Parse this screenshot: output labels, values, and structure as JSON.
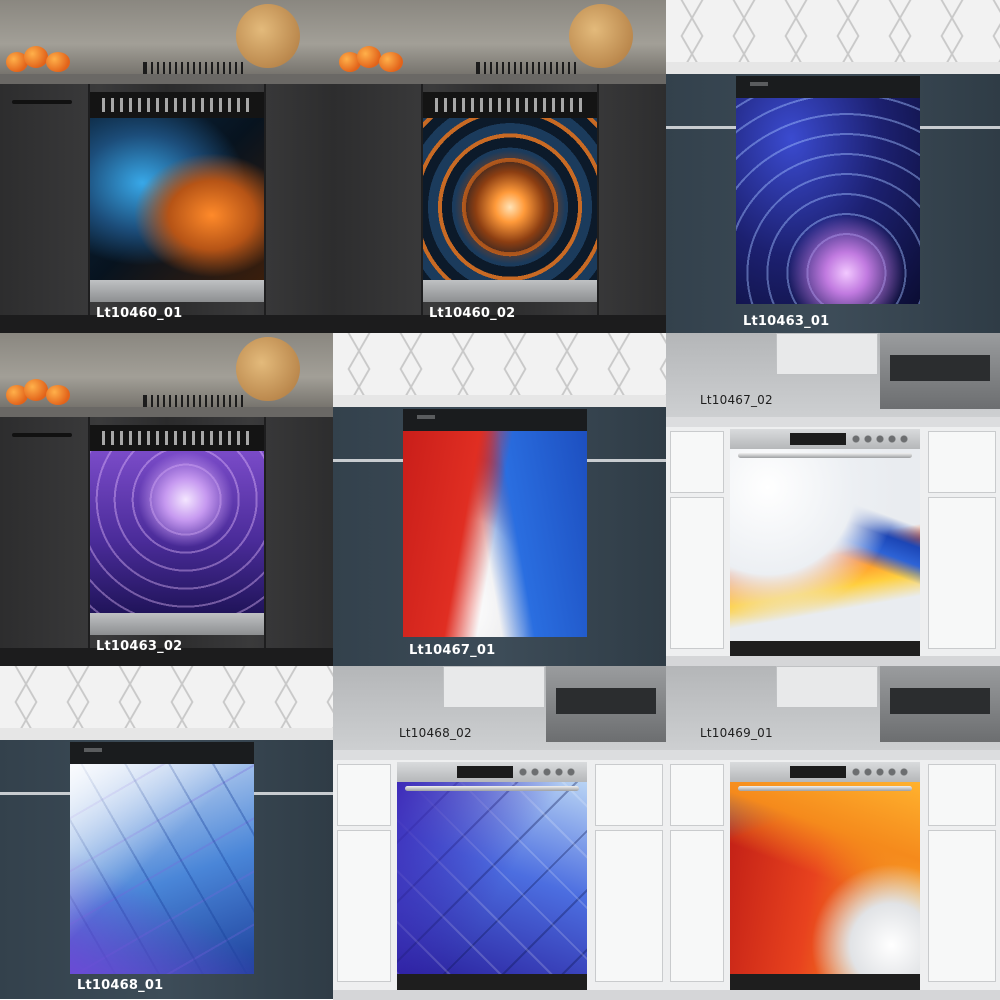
{
  "products": [
    {
      "code": "Lt10460_01",
      "kitchen": "dark",
      "artwork": "orange-blue-abstract"
    },
    {
      "code": "Lt10460_02",
      "kitchen": "dark",
      "artwork": "orange-tunnel-abstract"
    },
    {
      "code": "Lt10463_01",
      "kitchen": "navy",
      "artwork": "blue-cosmic-swirl"
    },
    {
      "code": "Lt10463_02",
      "kitchen": "dark",
      "artwork": "purple-cosmic-swirl"
    },
    {
      "code": "Lt10467_01",
      "kitchen": "navy",
      "artwork": "red-blue-white-waves"
    },
    {
      "code": "Lt10467_02",
      "kitchen": "white",
      "artwork": "orange-blue-white-waves"
    },
    {
      "code": "Lt10468_01",
      "kitchen": "navy",
      "artwork": "blue-purple-geometric"
    },
    {
      "code": "Lt10468_02",
      "kitchen": "white",
      "artwork": "purple-blue-geometric"
    },
    {
      "code": "Lt10469_01",
      "kitchen": "white",
      "artwork": "red-orange-swirl"
    }
  ],
  "colors": {
    "caption_light": "#ffffff",
    "caption_dark": "#1e1e1e",
    "dark_cabinet": "#333334",
    "navy_cabinet": "#3a4854",
    "white_cabinet": "#eeeff0"
  }
}
